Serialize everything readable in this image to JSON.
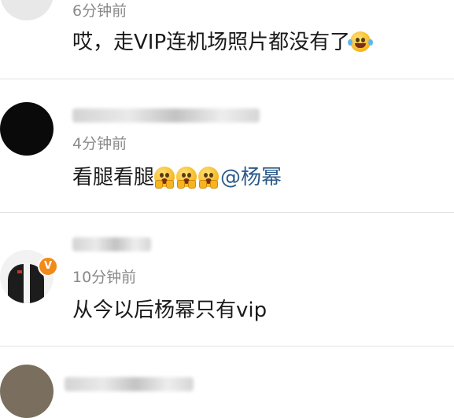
{
  "comments": [
    {
      "time": "6分钟前",
      "text": "哎，走VIP连机场照片都没有了",
      "emoji": [
        "laughing-crying-emoji"
      ]
    },
    {
      "time": "4分钟前",
      "text": "看腿看腿",
      "emoji": [
        "shocked-emoji",
        "shocked-emoji",
        "shocked-emoji"
      ],
      "mention": "@杨幂"
    },
    {
      "time": "10分钟前",
      "text": "从今以后杨幂只有vip",
      "verified_badge": "V"
    },
    {
      "time": ""
    }
  ],
  "colors": {
    "divider": "#e3e3e3",
    "time": "#8a8a8a",
    "text": "#1a1a1a",
    "mention": "#2c5a8a",
    "badge": "#f28a1a"
  }
}
